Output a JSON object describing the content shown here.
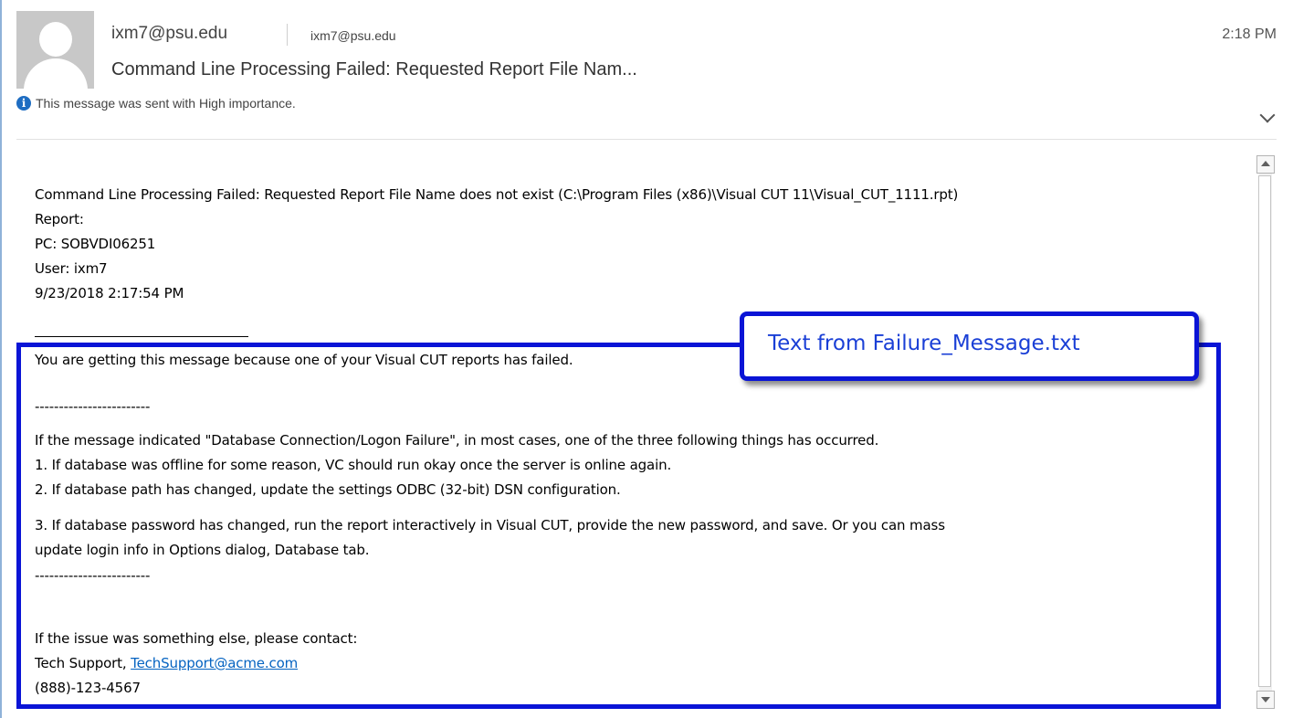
{
  "header": {
    "from": "ixm7@psu.edu",
    "to": "ixm7@psu.edu",
    "time": "2:18 PM",
    "subject": "Command Line Processing Failed: Requested Report File Nam...",
    "importance": "This message was sent with High importance."
  },
  "body": {
    "lines": [
      "Command Line Processing Failed: Requested Report File Name does not exist (C:\\Program Files (x86)\\Visual CUT 11\\Visual_CUT_1111.rpt)",
      "Report:",
      "PC: SOBVDI06251",
      "User: ixm7",
      "9/23/2018 2:17:54 PM"
    ],
    "failure_message": [
      "You are getting this message because one of your Visual CUT reports has failed.",
      "------------------------",
      "If the message indicated \"Database Connection/Logon Failure\", in most cases, one of the three following things has occurred.",
      "1. If database was offline for some reason, VC should run okay once the server is online again.",
      "2. If database path has changed, update the settings ODBC (32-bit) DSN configuration.",
      "3. If database password has changed, run the report interactively in Visual CUT, provide the new password, and save. Or you can mass",
      "update login info in Options dialog, Database tab.",
      "------------------------",
      "If the issue was something else, please contact:"
    ],
    "contact_prefix": "Tech Support, ",
    "contact_email": "TechSupport@acme.com",
    "phone": "(888)-123-4567"
  },
  "callout": {
    "text": "Text from Failure_Message.txt"
  },
  "colors": {
    "accent": "#0a14d6",
    "link": "#0563c1",
    "info_icon": "#1e6dc2"
  },
  "icons": [
    "avatar-placeholder",
    "info-icon",
    "chevron-down-icon",
    "scroll-up-icon",
    "scroll-down-icon"
  ]
}
